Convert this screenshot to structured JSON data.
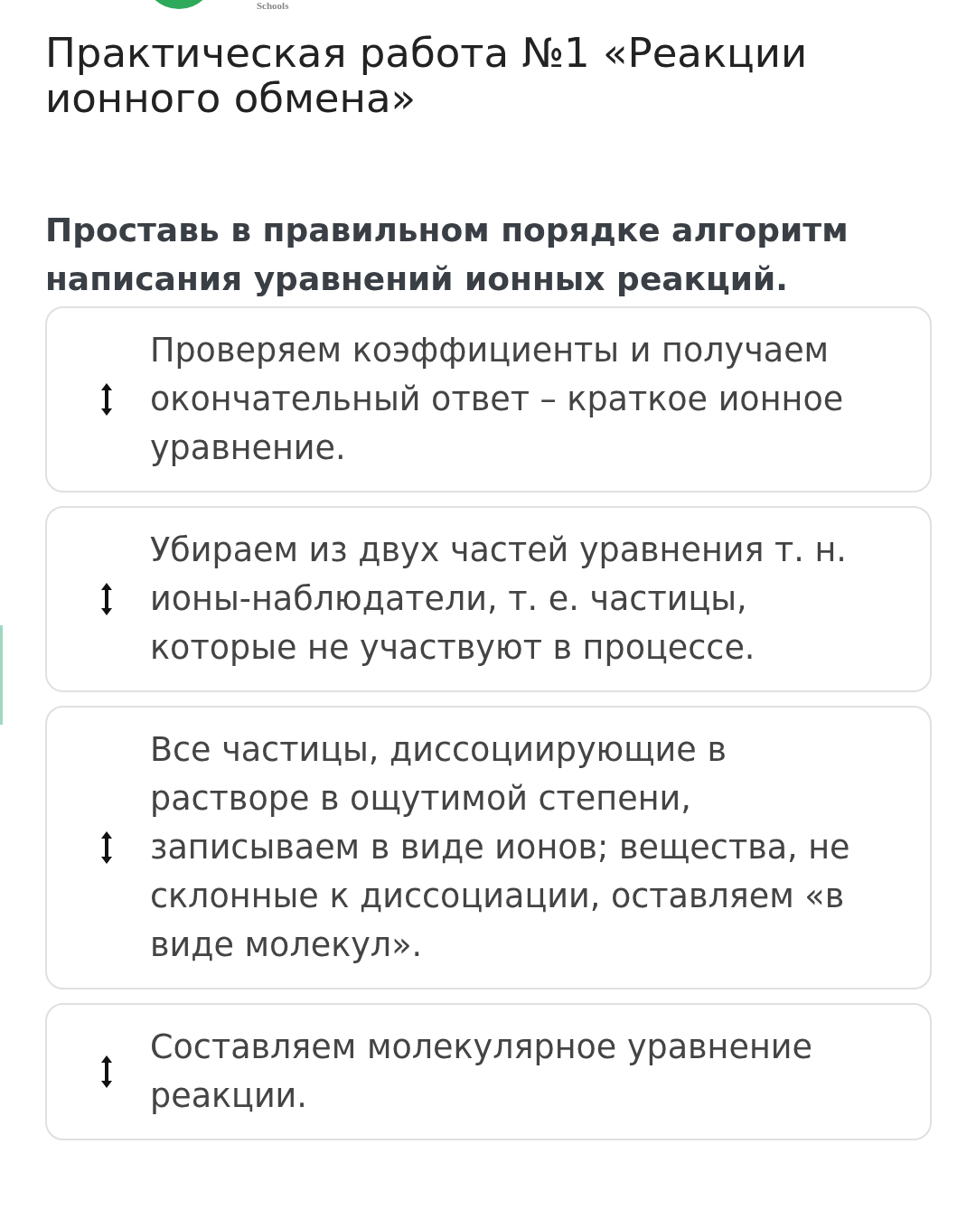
{
  "header": {
    "logo_caption": "Schools"
  },
  "title": "Практическая работа №1 «Реакции ионного обмена»",
  "question": "Проставь в правильном порядке алгоритм написания уравнений ионных реакций.",
  "items": [
    {
      "text": "Проверяем коэффициенты и получаем окончательный ответ – краткое ионное уравнение."
    },
    {
      "text": "Убираем из двух частей уравнения т. н. ионы-наблюдатели, т. е. частицы, которые не участвуют в процессе."
    },
    {
      "text": "Все частицы, диссоциирующие в растворе в ощутимой степени, записываем в виде ионов; вещества, не склонные к диссоциации, оставляем «в виде молекул»."
    },
    {
      "text": "Составляем молекулярное уравнение реакции."
    }
  ]
}
